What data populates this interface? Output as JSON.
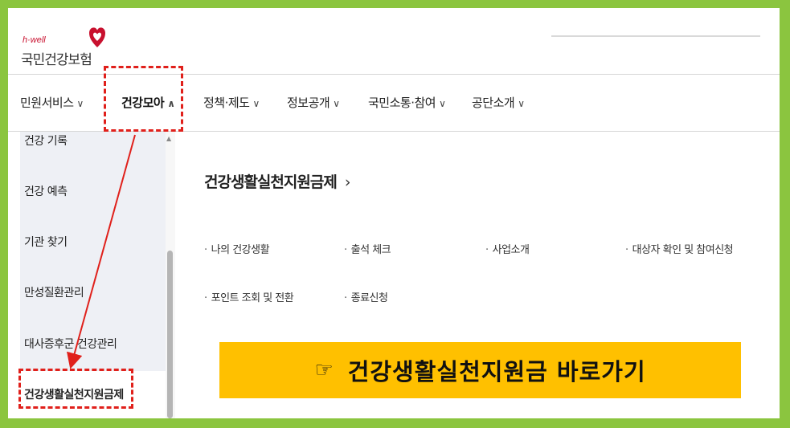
{
  "header": {
    "logo_small": "h·well",
    "logo_text": "국민건강보험"
  },
  "gnb": {
    "items": [
      {
        "label": "민원서비스",
        "chevron": "∨"
      },
      {
        "label": "건강모아",
        "chevron": "∧"
      },
      {
        "label": "정책·제도",
        "chevron": "∨"
      },
      {
        "label": "정보공개",
        "chevron": "∨"
      },
      {
        "label": "국민소통·참여",
        "chevron": "∨"
      },
      {
        "label": "공단소개",
        "chevron": "∨"
      }
    ]
  },
  "sidebar": {
    "items": [
      {
        "label": "건강 기록"
      },
      {
        "label": "건강 예측"
      },
      {
        "label": "기관 찾기"
      },
      {
        "label": "만성질환관리"
      },
      {
        "label": "대사증후군 건강관리"
      },
      {
        "label": "건강생활실천지원금제"
      }
    ],
    "scroll_up_icon": "triangle-up-icon"
  },
  "main": {
    "title": "건강생활실천지원금제",
    "title_chevron": "›",
    "links": [
      {
        "label": "나의 건강생활"
      },
      {
        "label": "출석 체크"
      },
      {
        "label": "사업소개"
      },
      {
        "label": "대상자 확인 및 참여신청"
      },
      {
        "label": "포인트 조회 및 전환"
      },
      {
        "label": "종료신청"
      }
    ],
    "bullet": "·"
  },
  "banner": {
    "hand": "☞",
    "text": "건강생활실천지원금 바로가기"
  },
  "colors": {
    "frame_border": "#8bc53f",
    "annotation_red": "#e0201b",
    "banner_bg": "#ffc000",
    "brand_red": "#c8102e"
  }
}
